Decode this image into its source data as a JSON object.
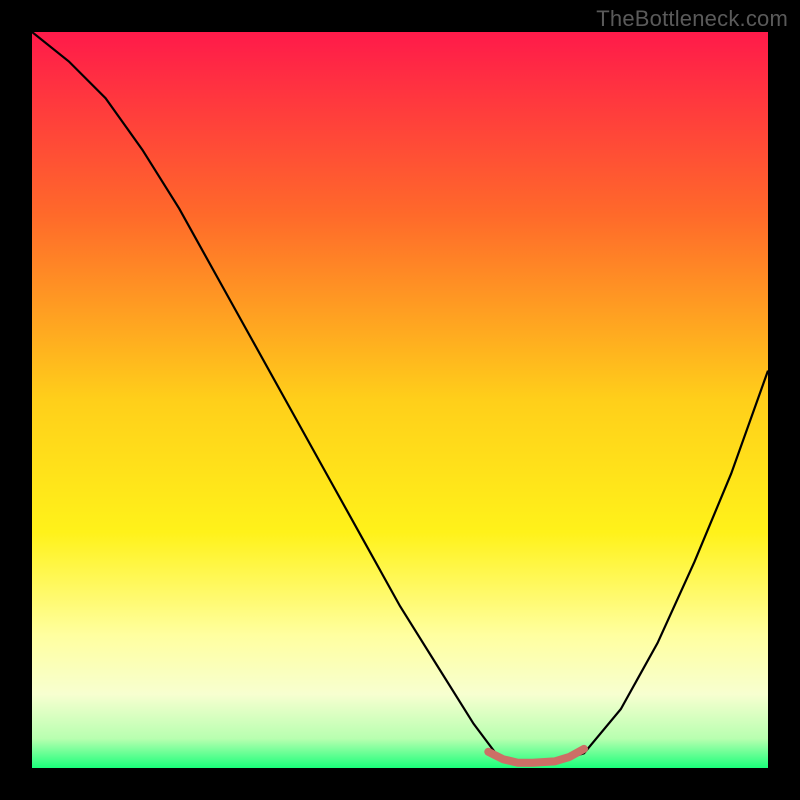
{
  "watermark": "TheBottleneck.com",
  "chart_data": {
    "type": "line",
    "title": "",
    "xlabel": "",
    "ylabel": "",
    "xlim": [
      0,
      100
    ],
    "ylim": [
      0,
      100
    ],
    "grid": false,
    "legend": false,
    "series": [
      {
        "name": "curve",
        "color": "#000000",
        "x": [
          0,
          5,
          10,
          15,
          20,
          25,
          30,
          35,
          40,
          45,
          50,
          55,
          60,
          63,
          66,
          70,
          75,
          80,
          85,
          90,
          95,
          100
        ],
        "y": [
          100,
          96,
          91,
          84,
          76,
          67,
          58,
          49,
          40,
          31,
          22,
          14,
          6,
          2,
          0.5,
          0.5,
          2,
          8,
          17,
          28,
          40,
          54
        ]
      },
      {
        "name": "highlight",
        "color": "#cc6f66",
        "x": [
          62,
          64,
          66,
          68,
          71,
          73,
          75
        ],
        "y": [
          2.2,
          1.2,
          0.7,
          0.7,
          0.9,
          1.5,
          2.6
        ]
      }
    ],
    "gradient_background": {
      "stops": [
        {
          "offset": 0,
          "color": "#ff1a4a"
        },
        {
          "offset": 25,
          "color": "#ff6a2a"
        },
        {
          "offset": 50,
          "color": "#ffcf1a"
        },
        {
          "offset": 68,
          "color": "#fff21a"
        },
        {
          "offset": 82,
          "color": "#ffffa0"
        },
        {
          "offset": 90,
          "color": "#f7ffd0"
        },
        {
          "offset": 96,
          "color": "#b8ffb0"
        },
        {
          "offset": 100,
          "color": "#1aff7a"
        }
      ]
    }
  }
}
